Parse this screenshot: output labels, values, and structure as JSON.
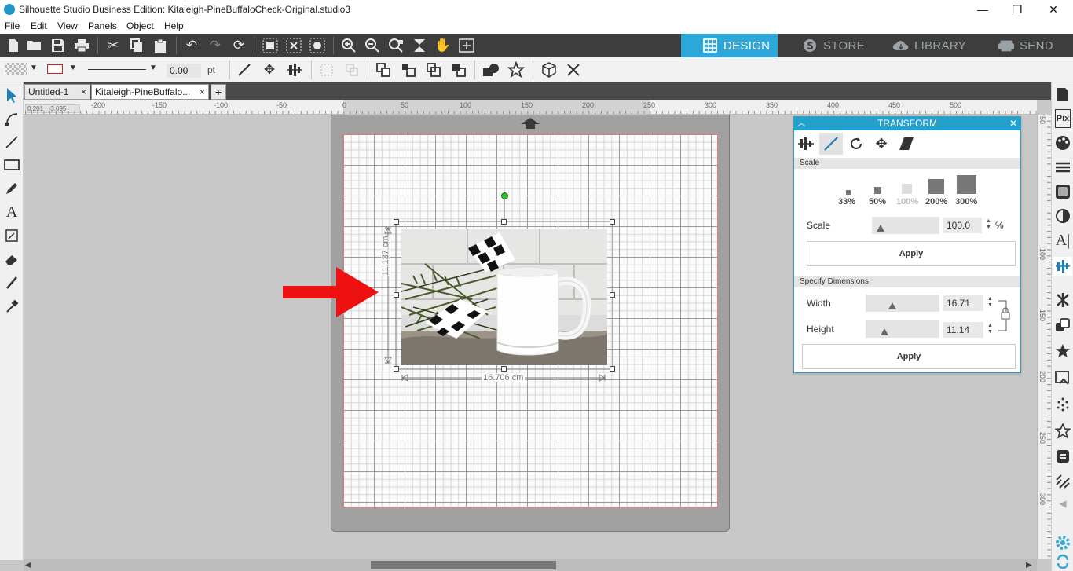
{
  "window": {
    "title": "Silhouette Studio Business Edition: Kitaleigh-PineBuffaloCheck-Original.studio3",
    "minimize": "—",
    "maximize": "❐",
    "close": "✕"
  },
  "menu": [
    "File",
    "Edit",
    "View",
    "Panels",
    "Object",
    "Help"
  ],
  "nav": {
    "design": "DESIGN",
    "store": "STORE",
    "library": "LIBRARY",
    "send": "SEND"
  },
  "line_toolbar": {
    "line_width": "0.00",
    "unit": "pt"
  },
  "doc_tabs": {
    "tab1": "Untitled-1",
    "tab2": "Kitaleigh-PineBuffalo...",
    "close": "×",
    "add": "+"
  },
  "ruler": {
    "coords": "0.201 , -3.095",
    "h_labels": [
      "-200",
      "-150",
      "-100",
      "-50",
      "0",
      "50",
      "100",
      "150",
      "200",
      "250",
      "300",
      "350",
      "400",
      "450",
      "500"
    ],
    "v_labels": [
      "50",
      "100",
      "150",
      "200",
      "250",
      "300"
    ]
  },
  "selection": {
    "width_label": "16.706 cm",
    "height_label": "11.137 cm"
  },
  "annotation": {
    "arrow_color": "#ee1111"
  },
  "transform_panel": {
    "title": "TRANSFORM",
    "scale_section": "Scale",
    "presets": [
      "33%",
      "50%",
      "100%",
      "200%",
      "300%"
    ],
    "scale_label": "Scale",
    "scale_value": "100.0",
    "percent": "%",
    "apply": "Apply",
    "dimensions_section": "Specify Dimensions",
    "width_label": "Width",
    "width_value": "16.71",
    "height_label": "Height",
    "height_value": "11.14",
    "apply2": "Apply"
  },
  "colors": {
    "accent": "#2ba8d9",
    "toolbar": "#3d3d3d",
    "mat": "#a1a1a1"
  }
}
